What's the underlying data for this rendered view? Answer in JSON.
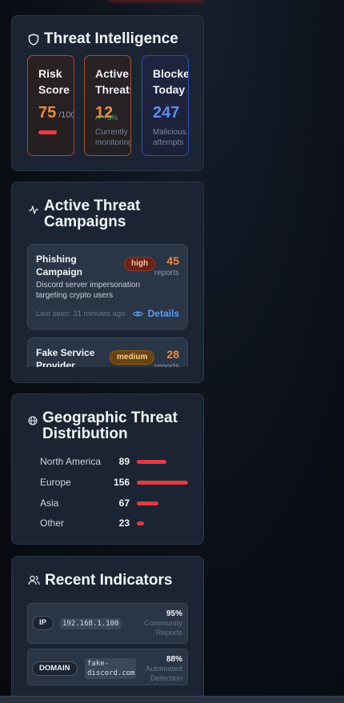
{
  "intel": {
    "title": "Threat Intelligence",
    "risk": {
      "label": "Risk Score",
      "value": "75",
      "suffix": "/100",
      "level": 0.75
    },
    "active": {
      "label": "Active Threats",
      "value": "12",
      "trend": "+3%",
      "sub": "Currently monitoring"
    },
    "blocked": {
      "label": "Blocked Today",
      "value": "247",
      "sub": "Malicious attempts"
    }
  },
  "campaigns": {
    "title": "Active Threat Campaigns",
    "items": [
      {
        "name": "Phishing Campaign",
        "severity": "high",
        "count": "45",
        "count_label": "reports",
        "desc": "Discord server impersonation targeting crypto users",
        "last_seen": "Last seen: 31 minutes ago",
        "details": "Details"
      },
      {
        "name": "Fake Service Provider",
        "severity": "medium",
        "count": "28",
        "count_label": "reports"
      }
    ]
  },
  "geo": {
    "title": "Geographic Threat Distribution",
    "rows": [
      {
        "name": "North America",
        "value": 89
      },
      {
        "name": "Europe",
        "value": 156
      },
      {
        "name": "Asia",
        "value": 67
      },
      {
        "name": "Other",
        "value": 23
      }
    ]
  },
  "indicators": {
    "title": "Recent Indicators",
    "items": [
      {
        "type": "IP",
        "value": "192.168.1.100",
        "confidence": "95%",
        "source": "Community Reports"
      },
      {
        "type": "DOMAIN",
        "value": "fake-discord.com",
        "confidence": "88%",
        "source": "Automated Detection"
      }
    ]
  },
  "colors": {
    "accent_orange": "#f2883b",
    "accent_blue": "#5b8ef5",
    "danger_red": "#ef3b3b",
    "trend_green": "#3bb273"
  }
}
